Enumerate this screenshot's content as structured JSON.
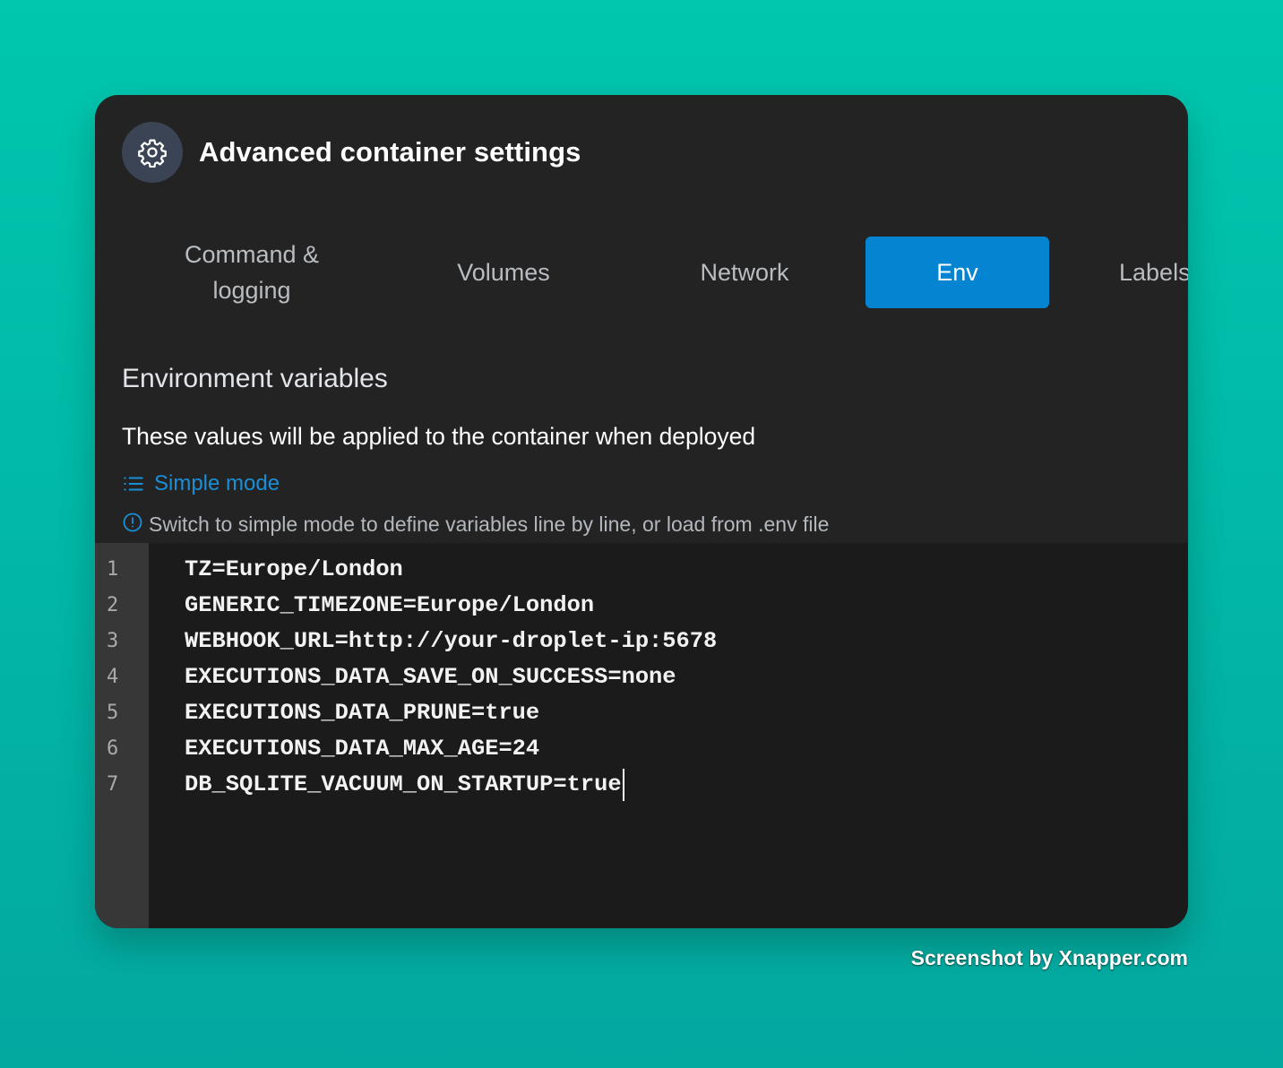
{
  "header": {
    "title": "Advanced container settings",
    "icon": "gear-icon"
  },
  "tabs": [
    {
      "label": "Command &\nlogging",
      "active": false
    },
    {
      "label": "Volumes",
      "active": false
    },
    {
      "label": "Network",
      "active": false
    },
    {
      "label": "Env",
      "active": true
    },
    {
      "label": "Labels",
      "active": false
    }
  ],
  "env": {
    "section_title": "Environment variables",
    "description": "These values will be applied to the container when deployed",
    "simple_mode_label": "Simple mode",
    "hint": "Switch to simple mode to define variables line by line, or load from .env file"
  },
  "editor": {
    "line_numbers": [
      "1",
      "2",
      "3",
      "4",
      "5",
      "6",
      "7"
    ],
    "lines": [
      "TZ=Europe/London",
      "GENERIC_TIMEZONE=Europe/London",
      "WEBHOOK_URL=http://your-droplet-ip:5678",
      "EXECUTIONS_DATA_SAVE_ON_SUCCESS=none",
      "EXECUTIONS_DATA_PRUNE=true",
      "EXECUTIONS_DATA_MAX_AGE=24",
      "DB_SQLITE_VACUUM_ON_STARTUP=true"
    ]
  },
  "footer": {
    "credit": "Screenshot by Xnapper.com"
  },
  "colors": {
    "background": "#00c7ae",
    "panel": "#232324",
    "accent": "#0584d1",
    "link": "#1a8fd8"
  }
}
